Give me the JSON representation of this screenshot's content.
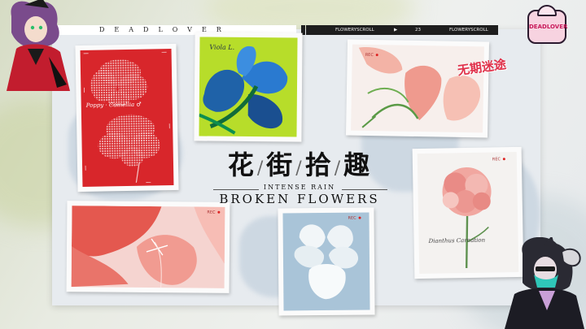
{
  "header": {
    "brand": "DEADLOVER",
    "bar_left": "FLOWERYSCROLL",
    "bar_page": "23",
    "bar_right": "FLOWERYSCROLL"
  },
  "title": {
    "chinese": [
      "花",
      "街",
      "拾",
      "趣"
    ],
    "separator": "/",
    "subtitle_small": "INTENSE RAIN",
    "subtitle_large": "BROKEN FLOWERS"
  },
  "stamp": "无期迷途",
  "logo_text": "DEADLOVER",
  "cards": [
    {
      "id": "red-cosmos",
      "caption": "Poppy · Camellia ♂",
      "rec": ""
    },
    {
      "id": "violet-blue",
      "caption": "Viola L.",
      "rec": ""
    },
    {
      "id": "pink-lisianthus",
      "caption": "",
      "rec": "REC"
    },
    {
      "id": "carnation",
      "caption": "Dianthus Carnation",
      "rec": "REC"
    },
    {
      "id": "red-poppy",
      "caption": "",
      "rec": "REC"
    },
    {
      "id": "white-pansy",
      "caption": "",
      "rec": "REC"
    }
  ],
  "colors": {
    "accent_red": "#d8262b",
    "stamp_red": "#e0314a",
    "board": "#e7ebef",
    "dark_bar": "#1e1e1e"
  }
}
